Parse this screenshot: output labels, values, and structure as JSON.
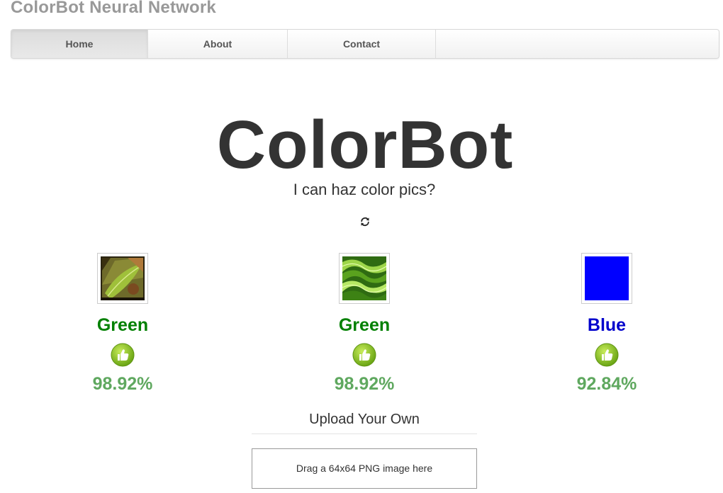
{
  "site": {
    "title": "ColorBot Neural Network"
  },
  "nav": {
    "items": [
      {
        "label": "Home",
        "active": true
      },
      {
        "label": "About",
        "active": false
      },
      {
        "label": "Contact",
        "active": false
      }
    ]
  },
  "hero": {
    "title": "ColorBot",
    "subtitle": "I can haz color pics?",
    "refresh_icon": "refresh-icon"
  },
  "results": [
    {
      "label": "Green",
      "confidence": "98.92%",
      "label_color": "#008000",
      "thumb_icon": "thumbs-up-icon",
      "image": "leaf-photo"
    },
    {
      "label": "Green",
      "confidence": "98.92%",
      "label_color": "#008000",
      "thumb_icon": "thumbs-up-icon",
      "image": "green-waves"
    },
    {
      "label": "Blue",
      "confidence": "92.84%",
      "label_color": "#0000cc",
      "thumb_icon": "thumbs-up-icon",
      "image": "solid-blue"
    }
  ],
  "upload": {
    "title": "Upload Your Own",
    "dropzone_text": "Drag a 64x64 PNG image here"
  },
  "colors": {
    "site_title": "#999999",
    "confidence": "#5fa85f",
    "blue_swatch": "#0000ff"
  }
}
